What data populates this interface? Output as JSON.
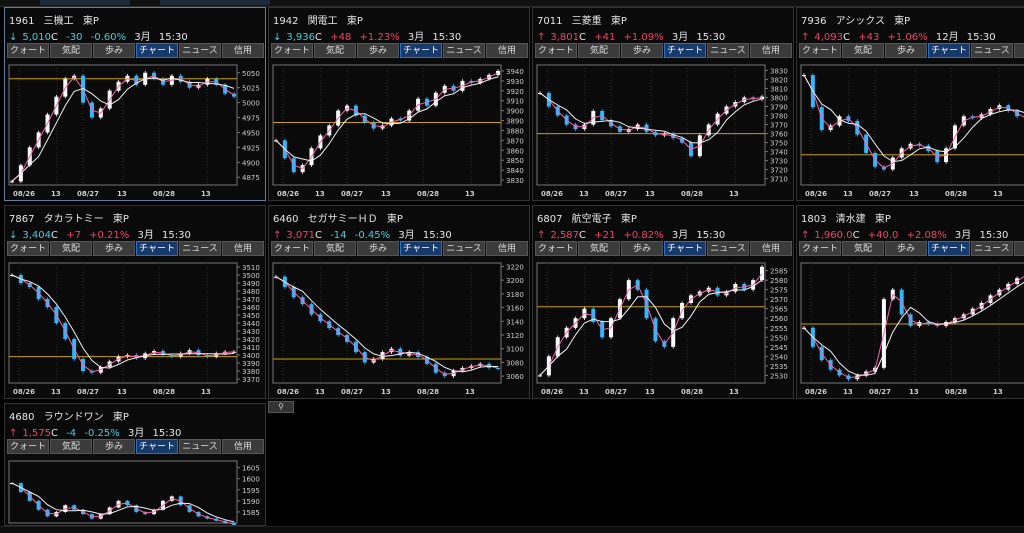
{
  "tab_labels": [
    "クォート",
    "気配",
    "歩み",
    "チャート",
    "ニュース",
    "信用"
  ],
  "active_tab_index": 3,
  "colors": {
    "up": "#ff3b6b",
    "down": "#3fd0e0",
    "ma1": "#ff5fa2",
    "ma2": "#f0f0f0",
    "ref": "#c8a000",
    "candle_up": "#ffffff",
    "candle_dn": "#2fb8ff"
  },
  "panels": [
    {
      "code": "1961",
      "name": "三機工",
      "market": "東P",
      "arrow": "↓",
      "dir": "down",
      "price": "5,010",
      "flag": "C",
      "change": "-30",
      "pct": "-0.60%",
      "month": "3月",
      "time": "15:30",
      "ticks": [
        "5050",
        "5025",
        "5000",
        "4975",
        "4950",
        "4925",
        "4900",
        "4875"
      ],
      "tick_values": [
        5050,
        5025,
        5000,
        4975,
        4950,
        4925,
        4900,
        4875
      ],
      "ymin": 4862,
      "ymax": 5063,
      "ref": 5040,
      "dates": [
        "08/26",
        "13",
        "08/27",
        "13",
        "08/28",
        "13"
      ],
      "series": [
        4868,
        4895,
        4925,
        4950,
        4980,
        5010,
        5040,
        5045,
        5000,
        4975,
        4990,
        5020,
        5035,
        5045,
        5030,
        5050,
        5040,
        5030,
        5045,
        5035,
        5025,
        5030,
        5040,
        5030,
        5015,
        5010
      ]
    },
    {
      "code": "1942",
      "name": "関電工",
      "market": "東P",
      "arrow": "↓",
      "dir": "down",
      "price": "3,936",
      "flag": "C",
      "change": "+48",
      "pct": "+1.23%",
      "month": "3月",
      "time": "15:30",
      "ticks": [
        "3940",
        "3930",
        "3920",
        "3910",
        "3900",
        "3890",
        "3880",
        "3870",
        "3860",
        "3850",
        "3840",
        "3830"
      ],
      "tick_values": [
        3940,
        3930,
        3920,
        3910,
        3900,
        3890,
        3880,
        3870,
        3860,
        3850,
        3840,
        3830
      ],
      "ymin": 3825,
      "ymax": 3946,
      "ref": 3888,
      "dates": [
        "08/26",
        "13",
        "08/27",
        "13",
        "08/28",
        "13"
      ],
      "series": [
        3870,
        3852,
        3838,
        3845,
        3862,
        3875,
        3885,
        3900,
        3905,
        3895,
        3888,
        3882,
        3885,
        3892,
        3890,
        3900,
        3912,
        3905,
        3918,
        3925,
        3920,
        3930,
        3928,
        3932,
        3936,
        3940
      ]
    },
    {
      "code": "7011",
      "name": "三菱重",
      "market": "東P",
      "arrow": "↑",
      "dir": "up",
      "price": "3,801",
      "flag": "C",
      "change": "+41",
      "pct": "+1.09%",
      "month": "3月",
      "time": "15:30",
      "ticks": [
        "3830",
        "3820",
        "3810",
        "3800",
        "3790",
        "3780",
        "3770",
        "3760",
        "3750",
        "3740",
        "3730",
        "3720",
        "3710"
      ],
      "tick_values": [
        3830,
        3820,
        3810,
        3800,
        3790,
        3780,
        3770,
        3760,
        3750,
        3740,
        3730,
        3720,
        3710
      ],
      "ymin": 3703,
      "ymax": 3836,
      "ref": 3760,
      "dates": [
        "08/26",
        "13",
        "08/27",
        "13",
        "08/28",
        "13"
      ],
      "series": [
        3805,
        3790,
        3780,
        3770,
        3765,
        3770,
        3785,
        3775,
        3768,
        3762,
        3765,
        3770,
        3762,
        3758,
        3760,
        3755,
        3750,
        3735,
        3758,
        3770,
        3782,
        3790,
        3795,
        3800,
        3798,
        3801
      ]
    },
    {
      "code": "7936",
      "name": "アシックス",
      "market": "東P",
      "arrow": "↑",
      "dir": "up",
      "price": "4,093",
      "flag": "C",
      "change": "+43",
      "pct": "+1.06%",
      "month": "12月",
      "time": "15:30",
      "ticks": [
        "3850",
        "3840",
        "3830",
        "3820",
        "3810",
        "3800",
        "3790",
        "3780",
        "3770",
        "3760",
        "3750",
        "3740",
        "3730"
      ],
      "tick_values": [
        3850,
        3840,
        3830,
        3820,
        3810,
        3800,
        3790,
        3780,
        3770,
        3760,
        3750,
        3740,
        3730
      ],
      "ymin": 3725,
      "ymax": 3856,
      "ref": 3758,
      "dates": [
        "08/26",
        "13",
        "08/27",
        "13",
        "08/28",
        "13"
      ],
      "series": [
        3845,
        3810,
        3785,
        3790,
        3800,
        3795,
        3780,
        3760,
        3745,
        3742,
        3755,
        3765,
        3770,
        3768,
        3762,
        3750,
        3765,
        3790,
        3800,
        3798,
        3802,
        3808,
        3812,
        3806,
        3800,
        3796
      ]
    },
    {
      "code": "7867",
      "name": "タカラトミー",
      "market": "東P",
      "arrow": "↓",
      "dir": "down",
      "price": "3,404",
      "flag": "C",
      "change": "+7",
      "pct": "+0.21%",
      "month": "3月",
      "time": "15:30",
      "ticks": [
        "3510",
        "3500",
        "3490",
        "3480",
        "3470",
        "3460",
        "3450",
        "3440",
        "3430",
        "3420",
        "3410",
        "3400",
        "3390",
        "3380",
        "3370"
      ],
      "tick_values": [
        3510,
        3500,
        3490,
        3480,
        3470,
        3460,
        3450,
        3440,
        3430,
        3420,
        3410,
        3400,
        3390,
        3380,
        3370
      ],
      "ymin": 3365,
      "ymax": 3515,
      "ref": 3398,
      "dates": [
        "08/26",
        "13",
        "08/27",
        "13",
        "08/28",
        "13"
      ],
      "series": [
        3500,
        3490,
        3485,
        3470,
        3460,
        3440,
        3420,
        3395,
        3380,
        3378,
        3385,
        3392,
        3398,
        3400,
        3396,
        3402,
        3405,
        3400,
        3398,
        3402,
        3406,
        3400,
        3398,
        3402,
        3404,
        3404
      ]
    },
    {
      "code": "6460",
      "name": "セガサミーＨＤ",
      "market": "東P",
      "arrow": "↑",
      "dir": "up",
      "price": "3,071",
      "flag": "C",
      "change": "-14",
      "pct": "-0.45%",
      "month": "3月",
      "time": "15:30",
      "ticks": [
        "3220",
        "3200",
        "3180",
        "3160",
        "3140",
        "3120",
        "3100",
        "3080",
        "3060"
      ],
      "tick_values": [
        3220,
        3200,
        3180,
        3160,
        3140,
        3120,
        3100,
        3080,
        3060
      ],
      "ymin": 3050,
      "ymax": 3225,
      "ref": 3085,
      "dates": [
        "08/26",
        "13",
        "08/27",
        "13",
        "08/28",
        "13"
      ],
      "series": [
        3205,
        3190,
        3175,
        3165,
        3150,
        3140,
        3130,
        3120,
        3110,
        3095,
        3080,
        3085,
        3095,
        3100,
        3090,
        3095,
        3088,
        3078,
        3065,
        3060,
        3068,
        3072,
        3075,
        3078,
        3072,
        3071
      ]
    },
    {
      "code": "6807",
      "name": "航空電子",
      "market": "東P",
      "arrow": "↑",
      "dir": "up",
      "price": "2,587",
      "flag": "C",
      "change": "+21",
      "pct": "+0.82%",
      "month": "3月",
      "time": "15:30",
      "ticks": [
        "2585",
        "2580",
        "2575",
        "2570",
        "2565",
        "2560",
        "2555",
        "2550",
        "2545",
        "2540",
        "2535",
        "2530"
      ],
      "tick_values": [
        2585,
        2580,
        2575,
        2570,
        2565,
        2560,
        2555,
        2550,
        2545,
        2540,
        2535,
        2530
      ],
      "ymin": 2526,
      "ymax": 2589,
      "ref": 2566,
      "dates": [
        "08/26",
        "13",
        "08/27",
        "13",
        "08/28",
        "13"
      ],
      "series": [
        2530,
        2540,
        2550,
        2555,
        2560,
        2565,
        2558,
        2550,
        2560,
        2570,
        2580,
        2575,
        2560,
        2548,
        2545,
        2560,
        2568,
        2572,
        2574,
        2576,
        2572,
        2574,
        2578,
        2575,
        2580,
        2587
      ]
    },
    {
      "code": "1803",
      "name": "清水建",
      "market": "東P",
      "arrow": "↑",
      "dir": "up",
      "price": "1,960.0",
      "flag": "C",
      "change": "+40.0",
      "pct": "+2.08%",
      "month": "3月",
      "time": "15:30",
      "ticks": [
        "2585",
        "2580",
        "2575",
        "2570",
        "2565",
        "2560",
        "2555",
        "2550",
        "2545",
        "2540",
        "2535",
        "2530"
      ],
      "tick_values": [
        2585,
        2580,
        2575,
        2570,
        2565,
        2560,
        2555,
        2550,
        2545,
        2540,
        2535,
        2530
      ],
      "ymin": 2526,
      "ymax": 2589,
      "ref": 2557,
      "dates": [
        "08/26",
        "13",
        "08/27",
        "13",
        "08/28",
        "13"
      ],
      "series": [
        2555,
        2545,
        2538,
        2533,
        2530,
        2528,
        2530,
        2532,
        2534,
        2570,
        2575,
        2562,
        2556,
        2558,
        2557,
        2556,
        2558,
        2560,
        2562,
        2565,
        2568,
        2572,
        2575,
        2578,
        2581,
        2584
      ]
    },
    {
      "code": "4680",
      "name": "ラウンドワン",
      "market": "東P",
      "arrow": "↑",
      "dir": "up",
      "price": "1,575",
      "flag": "C",
      "change": "-4",
      "pct": "-0.25%",
      "month": "3月",
      "time": "15:30",
      "ticks": [
        "1605",
        "1600",
        "1595",
        "1590",
        "1585"
      ],
      "tick_values": [
        1605,
        1600,
        1595,
        1590,
        1585
      ],
      "ymin": 1580,
      "ymax": 1608,
      "ref": null,
      "dates": [],
      "series": [
        1598,
        1594,
        1590,
        1586,
        1583,
        1585,
        1588,
        1586,
        1584,
        1582,
        1584,
        1587,
        1590,
        1588,
        1585,
        1584,
        1586,
        1590,
        1592,
        1588,
        1585,
        1583,
        1582,
        1581,
        1580,
        1579
      ]
    }
  ]
}
